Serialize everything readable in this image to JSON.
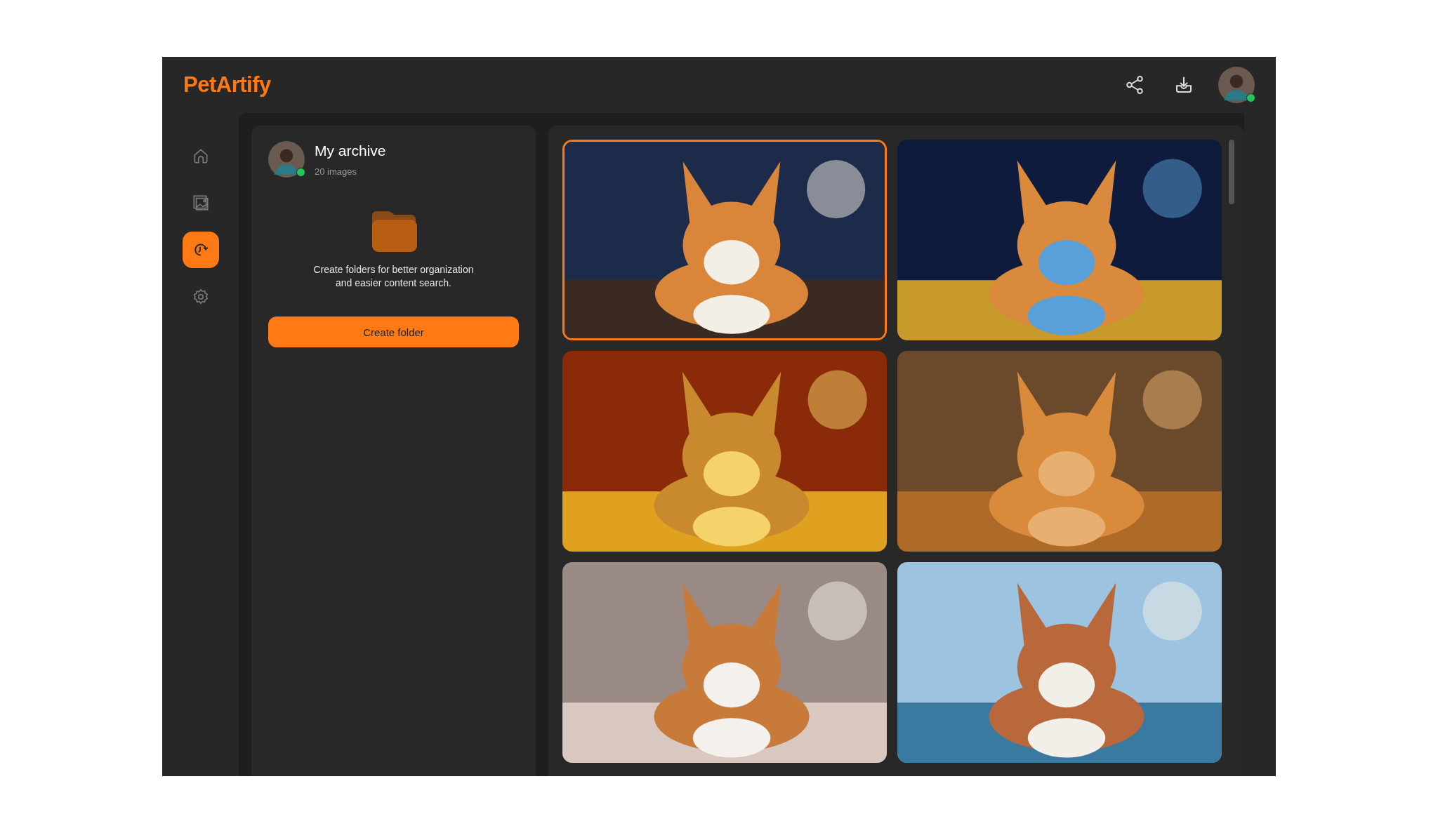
{
  "app": {
    "name": "PetArtify"
  },
  "header_actions": [
    {
      "kind": "share"
    },
    {
      "kind": "download"
    }
  ],
  "user": {
    "online": true
  },
  "nav": [
    {
      "kind": "home",
      "selected": false
    },
    {
      "kind": "gallery",
      "selected": false
    },
    {
      "kind": "history",
      "selected": true
    },
    {
      "kind": "settings",
      "selected": false
    }
  ],
  "archive": {
    "title": "My archive",
    "count": "20 images",
    "owner_online": true,
    "empty_message": "Create folders for better organization and easier content search.",
    "button": "Create folder"
  },
  "gallery": [
    {
      "kind": "picture",
      "selected": true
    },
    {
      "kind": "picture",
      "selected": false
    },
    {
      "kind": "picture",
      "selected": false
    },
    {
      "kind": "picture",
      "selected": false
    },
    {
      "kind": "picture",
      "selected": false
    },
    {
      "kind": "picture",
      "selected": false
    }
  ]
}
